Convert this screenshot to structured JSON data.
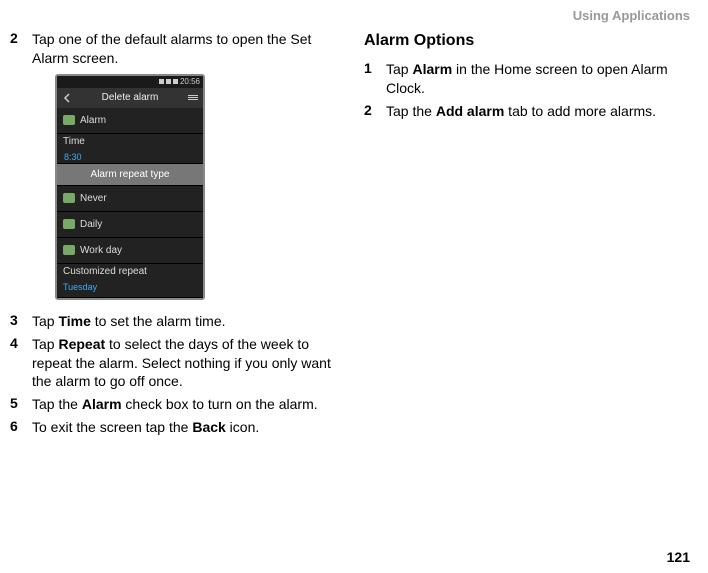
{
  "header": "Using Applications",
  "page_number": "121",
  "left": {
    "step2": {
      "num": "2",
      "text_before": "Tap one of the default alarms to open the Set Alarm screen."
    },
    "step3": {
      "num": "3",
      "pre": "Tap ",
      "bold": "Time",
      "post": " to set the alarm time."
    },
    "step4": {
      "num": "4",
      "pre": "Tap ",
      "bold": "Repeat",
      "post": " to select the days of the week to repeat the alarm. Select nothing if you only want the alarm to go off once."
    },
    "step5": {
      "num": "5",
      "pre": "Tap the ",
      "bold": "Alarm",
      "post": " check box to turn on the alarm."
    },
    "step6": {
      "num": "6",
      "pre": "To exit the screen tap the ",
      "bold": "Back",
      "post": " icon."
    }
  },
  "right": {
    "title": "Alarm Options",
    "step1": {
      "num": "1",
      "pre": "Tap ",
      "bold": "Alarm",
      "post": " in the Home screen to open Alarm Clock."
    },
    "step2": {
      "num": "2",
      "pre": "Tap the ",
      "bold": "Add alarm",
      "post": " tab to add more alarms."
    }
  },
  "phone": {
    "status_time": "20:56",
    "topbar": "Delete alarm",
    "row_alarm": "Alarm",
    "row_time_label": "Time",
    "row_time_value": "8:30",
    "row_repeat": "Alarm repeat type",
    "row_never": "Never",
    "row_daily": "Daily",
    "row_workday": "Work day",
    "row_custom_label": "Customized repeat",
    "row_custom_value": "Tuesday"
  }
}
